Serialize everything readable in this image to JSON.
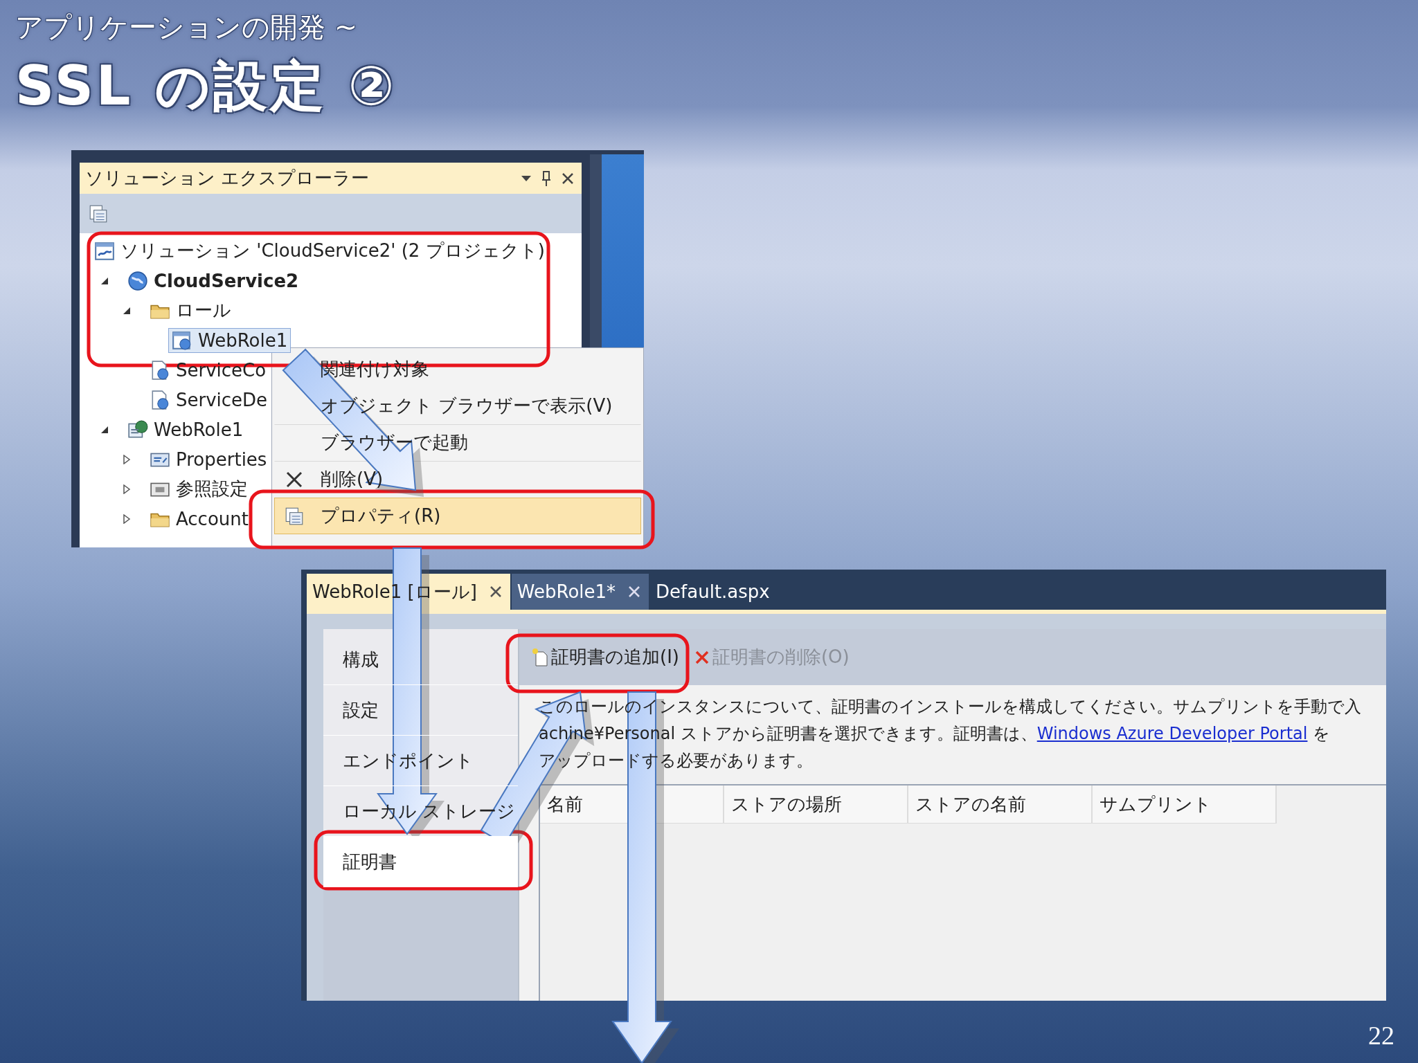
{
  "slide": {
    "subtitle": "アプリケーションの開発 ~",
    "title": "SSL の設定 ②",
    "page_number": "22"
  },
  "solution_explorer": {
    "title": "ソリューション エクスプローラー",
    "tree": [
      {
        "label": "ソリューション 'CloudService2' (2 プロジェクト)",
        "kind": "solution",
        "selected": false,
        "children": [
          {
            "label": "CloudService2",
            "kind": "cloud",
            "bold": true,
            "expanded": true,
            "selected": false,
            "children": [
              {
                "label": "ロール",
                "kind": "folder",
                "expanded": true,
                "selected": false,
                "children": [
                  {
                    "label": "WebRole1",
                    "kind": "role",
                    "selected": true
                  }
                ]
              },
              {
                "label": "ServiceCo",
                "kind": "config",
                "selected": false
              },
              {
                "label": "ServiceDe",
                "kind": "config",
                "selected": false
              }
            ]
          },
          {
            "label": "WebRole1",
            "kind": "project",
            "expanded": true,
            "selected": false,
            "children": [
              {
                "label": "Properties",
                "kind": "properties",
                "expanded": false,
                "selected": false
              },
              {
                "label": "参照設定",
                "kind": "references",
                "expanded": false,
                "selected": false
              },
              {
                "label": "Account",
                "kind": "folder",
                "expanded": false,
                "selected": false
              }
            ]
          }
        ]
      }
    ]
  },
  "context_menu": [
    {
      "label": "関連付け対象",
      "selected": false
    },
    {
      "label": "オブジェクト ブラウザーで表示(V)",
      "selected": false
    },
    {
      "label": "ブラウザーで起動",
      "selected": false
    },
    {
      "label": "削除(V)",
      "kind": "delete",
      "selected": false
    },
    {
      "label": "プロパティ(R)",
      "kind": "properties",
      "selected": true
    }
  ],
  "designer": {
    "tabs": [
      {
        "label": "WebRole1 [ロール]",
        "selected": true,
        "closable": true
      },
      {
        "label": "WebRole1*",
        "selected": false,
        "closable": true
      },
      {
        "label": "Default.aspx",
        "selected": false,
        "closable": false
      }
    ],
    "nav": [
      {
        "label": "構成",
        "selected": false
      },
      {
        "label": "設定",
        "selected": false
      },
      {
        "label": "エンドポイント",
        "selected": false
      },
      {
        "label": "ローカル ストレージ",
        "selected": false
      },
      {
        "label": "証明書",
        "selected": true
      }
    ],
    "toolbar": [
      {
        "label": "証明書の追加(I)",
        "kind": "add",
        "disabled": false
      },
      {
        "label": "証明書の削除(O)",
        "kind": "remove",
        "disabled": true
      }
    ],
    "description": [
      {
        "text": "このロールのインスタンスについて、証明書のインストールを構成してください。サムプリントを手動で入"
      },
      {
        "text": "achine¥Personal ストアから証明書を選択できます。証明書は、",
        "link": "Windows Azure Developer Portal",
        "after": " を"
      },
      {
        "text": "アップロードする必要があります。"
      }
    ],
    "table": {
      "columns": [
        "名前",
        "ストアの場所",
        "ストアの名前",
        "サムプリント"
      ]
    }
  }
}
